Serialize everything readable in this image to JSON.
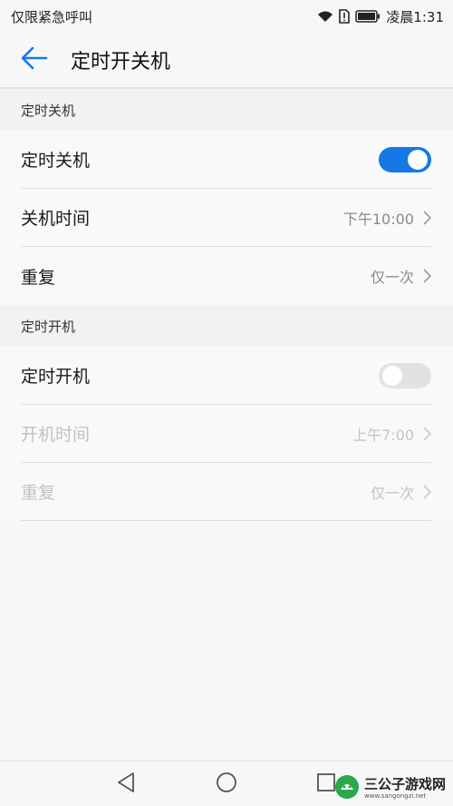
{
  "status_bar": {
    "carrier_text": "仅限紧急呼叫",
    "time": "凌晨1:31",
    "icons": [
      "wifi-icon",
      "sim-alert-icon",
      "battery-icon"
    ]
  },
  "header": {
    "back_icon": "arrow-left-icon",
    "title": "定时开关机"
  },
  "shutdown_section": {
    "title": "定时关机",
    "toggle_row": {
      "label": "定时关机",
      "enabled": true
    },
    "time_row": {
      "label": "关机时间",
      "value": "下午10:00"
    },
    "repeat_row": {
      "label": "重复",
      "value": "仅一次"
    }
  },
  "startup_section": {
    "title": "定时开机",
    "toggle_row": {
      "label": "定时开机",
      "enabled": false
    },
    "time_row": {
      "label": "开机时间",
      "value": "上午7:00"
    },
    "repeat_row": {
      "label": "重复",
      "value": "仅一次"
    }
  },
  "nav_bar": {
    "buttons": [
      "back-triangle-icon",
      "home-circle-icon",
      "recents-square-icon"
    ]
  },
  "watermark": {
    "title": "三公子游戏网",
    "url": "www.sangongzi.net"
  },
  "colors": {
    "accent": "#1478e6",
    "background": "#f7f7f7",
    "toggle_off": "#e2e2e2"
  }
}
